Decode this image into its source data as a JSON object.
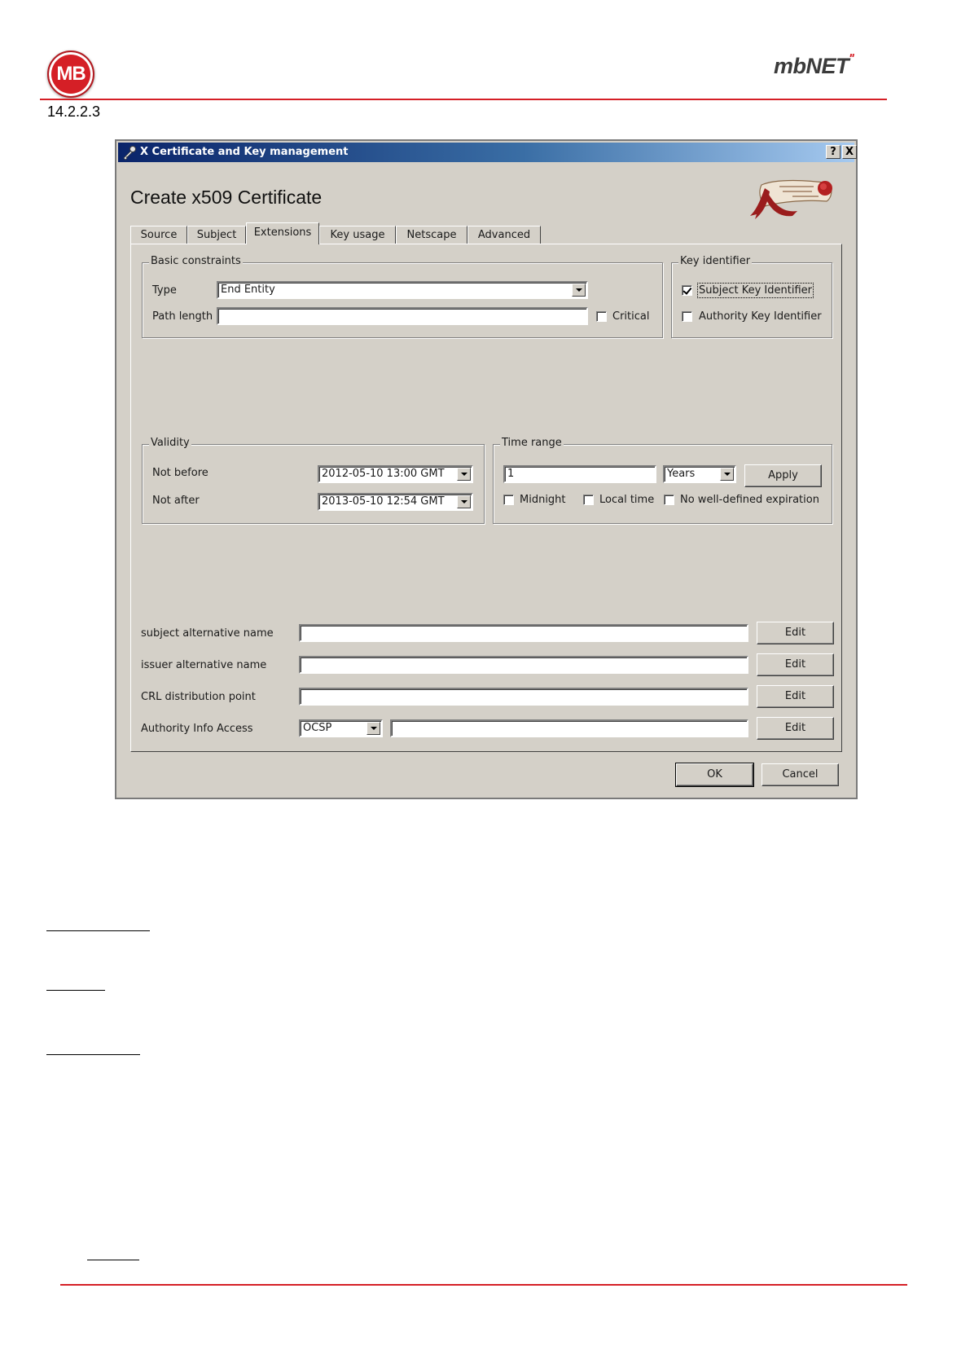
{
  "header": {
    "brand_left": "MB",
    "brand_right": "mbNET",
    "section_number": "14.2.2.3"
  },
  "window": {
    "title": "X Certificate and Key management",
    "help_button": "?",
    "close_button": "X"
  },
  "dialog": {
    "heading": "Create x509 Certificate",
    "tabs": [
      {
        "label": "Source"
      },
      {
        "label": "Subject"
      },
      {
        "label": "Extensions",
        "active": true
      },
      {
        "label": "Key usage"
      },
      {
        "label": "Netscape"
      },
      {
        "label": "Advanced"
      }
    ],
    "basic_constraints": {
      "title": "Basic constraints",
      "type_label": "Type",
      "type_value": "End Entity",
      "path_length_label": "Path length",
      "path_length_value": "",
      "critical_label": "Critical",
      "critical_checked": false
    },
    "key_identifier": {
      "title": "Key identifier",
      "subject_key_label": "Subject Key Identifier",
      "subject_key_checked": true,
      "authority_key_label": "Authority Key Identifier",
      "authority_key_checked": false
    },
    "validity": {
      "title": "Validity",
      "not_before_label": "Not before",
      "not_before_value": "2012-05-10 13:00 GMT",
      "not_after_label": "Not after",
      "not_after_value": "2013-05-10 12:54 GMT"
    },
    "time_range": {
      "title": "Time range",
      "amount_value": "1",
      "unit_value": "Years",
      "apply_label": "Apply",
      "midnight_label": "Midnight",
      "local_time_label": "Local time",
      "no_expiration_label": "No well-defined expiration"
    },
    "extensions": [
      {
        "label": "subject alternative name",
        "value": "",
        "edit": "Edit"
      },
      {
        "label": "issuer alternative name",
        "value": "",
        "edit": "Edit"
      },
      {
        "label": "CRL distribution point",
        "value": "",
        "edit": "Edit"
      },
      {
        "label": "Authority Info Access",
        "method": "OCSP",
        "value": "",
        "edit": "Edit"
      }
    ],
    "ok_label": "OK",
    "cancel_label": "Cancel"
  }
}
